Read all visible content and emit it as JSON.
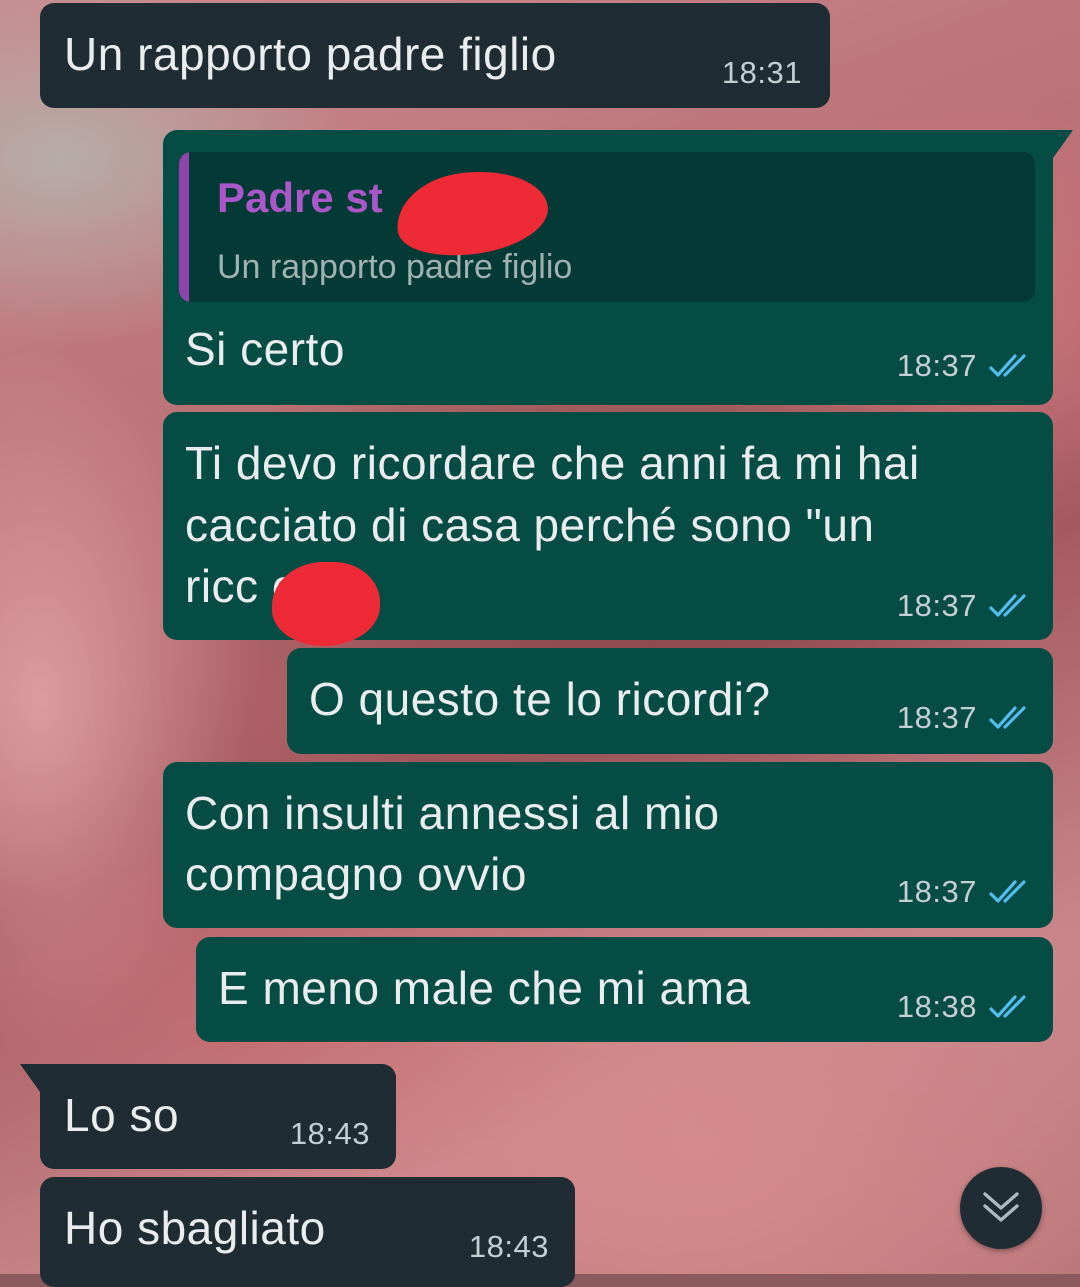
{
  "messages": [
    {
      "text": "Un rapporto padre figlio",
      "time": "18:31",
      "direction": "incoming"
    },
    {
      "reply_to": {
        "author": "Padre st",
        "text": "Un rapporto padre figlio"
      },
      "text": "Si certo",
      "time": "18:37",
      "direction": "outgoing",
      "status": "read"
    },
    {
      "lines": [
        "Ti devo ricordare che anni fa mi hai",
        "cacciato di casa perché sono \"un",
        "ricc      e\"?"
      ],
      "time": "18:37",
      "direction": "outgoing",
      "status": "read"
    },
    {
      "text": "O questo te lo ricordi?",
      "time": "18:37",
      "direction": "outgoing",
      "status": "read"
    },
    {
      "lines": [
        "Con insulti annessi al mio",
        "compagno ovvio"
      ],
      "time": "18:37",
      "direction": "outgoing",
      "status": "read"
    },
    {
      "text": "E meno male che mi ama",
      "time": "18:38",
      "direction": "outgoing",
      "status": "read"
    },
    {
      "text": "Lo so",
      "time": "18:43",
      "direction": "incoming"
    },
    {
      "text": "Ho sbagliato",
      "time": "18:43",
      "direction": "incoming"
    }
  ],
  "colors": {
    "incoming_bubble": "#202c33",
    "outgoing_bubble": "#054c44",
    "read_ticks": "#53bdeb",
    "quote_author": "#a957c9",
    "redaction": "#ee2a37"
  },
  "icons": {
    "read_status": "double-check-icon",
    "scroll_down": "chevron-double-down-icon"
  }
}
